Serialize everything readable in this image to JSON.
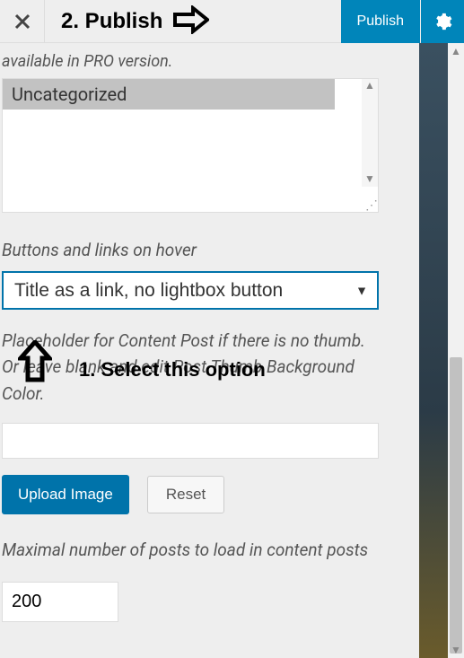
{
  "topbar": {
    "publish_label": "Publish"
  },
  "annotations": {
    "step2": "2. Publish",
    "step1": "1. Select this option"
  },
  "panel": {
    "pro_note": "available in PRO version.",
    "categories": [
      "Uncategorized"
    ],
    "hover_label": "Buttons and links on hover",
    "hover_selected": "Title as a link, no lightbox button",
    "placeholder_desc": "Placeholder for Content Post if there is no thumb. Or leave blank and edit Post Thumb Background Color.",
    "upload_label": "Upload Image",
    "reset_label": "Reset",
    "max_posts_label": "Maximal number of posts to load in content posts",
    "max_posts_value": "200"
  }
}
